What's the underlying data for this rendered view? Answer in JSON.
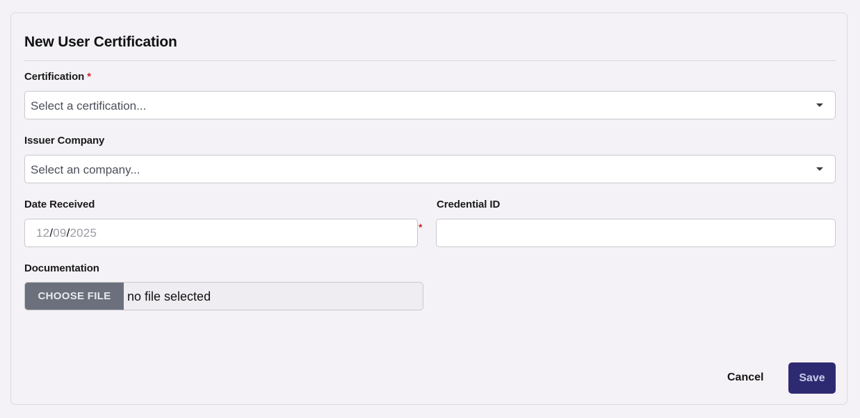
{
  "form": {
    "title": "New User Certification",
    "certification": {
      "label": "Certification",
      "required_mark": "*",
      "placeholder": "Select a certification..."
    },
    "issuer": {
      "label": "Issuer Company",
      "placeholder": "Select an company..."
    },
    "date_received": {
      "label": "Date Received",
      "month": "12",
      "day": "09",
      "year": "2025",
      "separator": "/",
      "required_mark": "*"
    },
    "credential_id": {
      "label": "Credential ID",
      "value": ""
    },
    "documentation": {
      "label": "Documentation",
      "button_label": "CHOOSE FILE",
      "status": "no file selected"
    },
    "actions": {
      "cancel_label": "Cancel",
      "save_label": "Save"
    }
  },
  "colors": {
    "background": "#f4f2f6",
    "required": "#d0282e",
    "save_button": "#2e2a72",
    "file_button": "#6b707c"
  },
  "icons": {
    "dropdown": "caret-down-icon"
  }
}
